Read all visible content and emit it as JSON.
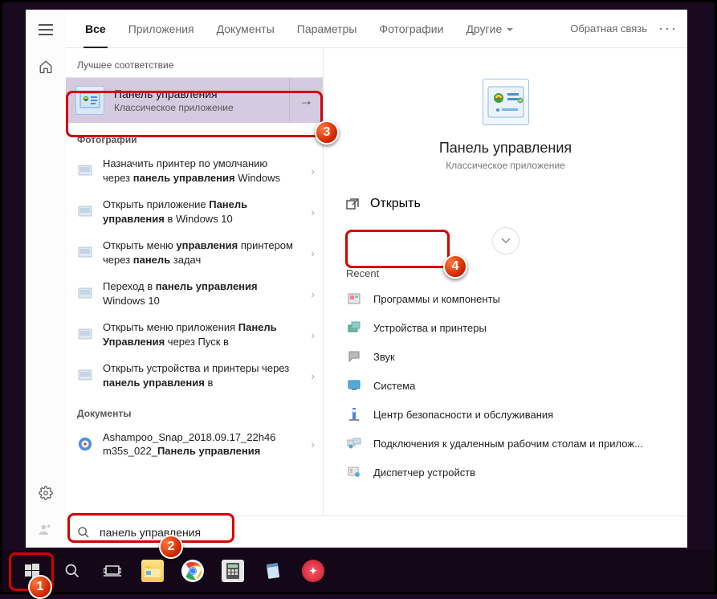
{
  "tabs": {
    "all": "Все",
    "apps": "Приложения",
    "docs": "Документы",
    "settings": "Параметры",
    "photos": "Фотографии",
    "more": "Другие",
    "feedback": "Обратная связь"
  },
  "sections": {
    "best": "Лучшее соответствие",
    "photos": "Фотографии",
    "docs": "Документы"
  },
  "best": {
    "title": "Панель управления",
    "subtitle": "Классическое приложение"
  },
  "results": [
    {
      "pre": "Назначить принтер по умолчанию через ",
      "b": "панель управления",
      "post": " Windows"
    },
    {
      "pre": "Открыть приложение ",
      "b": "Панель управления",
      "post": " в Windows 10"
    },
    {
      "pre": "Открыть меню ",
      "b": "управления",
      "post": " принтером через ",
      "b2": "панель",
      "post2": " задач"
    },
    {
      "pre": "Переход в ",
      "b": "панель управления",
      "post": " Windows 10"
    },
    {
      "pre": "Открыть меню приложения ",
      "b": "Панель Управления",
      "post": " через Пуск в"
    },
    {
      "pre": "Открыть устройства и принтеры через ",
      "b": "панель управления",
      "post": " в"
    }
  ],
  "doc_result": {
    "line1": "Ashampoo_Snap_2018.09.17_22h46",
    "line2": "m35s_022_",
    "b": "Панель управления"
  },
  "detail": {
    "title": "Панель управления",
    "subtitle": "Классическое приложение",
    "open": "Открыть",
    "recent": "Recent",
    "items": [
      "Программы и компоненты",
      "Устройства и принтеры",
      "Звук",
      "Система",
      "Центр безопасности и обслуживания",
      "Подключения к удаленным рабочим столам и прилож...",
      "Диспетчер устройств"
    ]
  },
  "search": {
    "value": "панель управления"
  },
  "badges": {
    "1": "1",
    "2": "2",
    "3": "3",
    "4": "4"
  }
}
